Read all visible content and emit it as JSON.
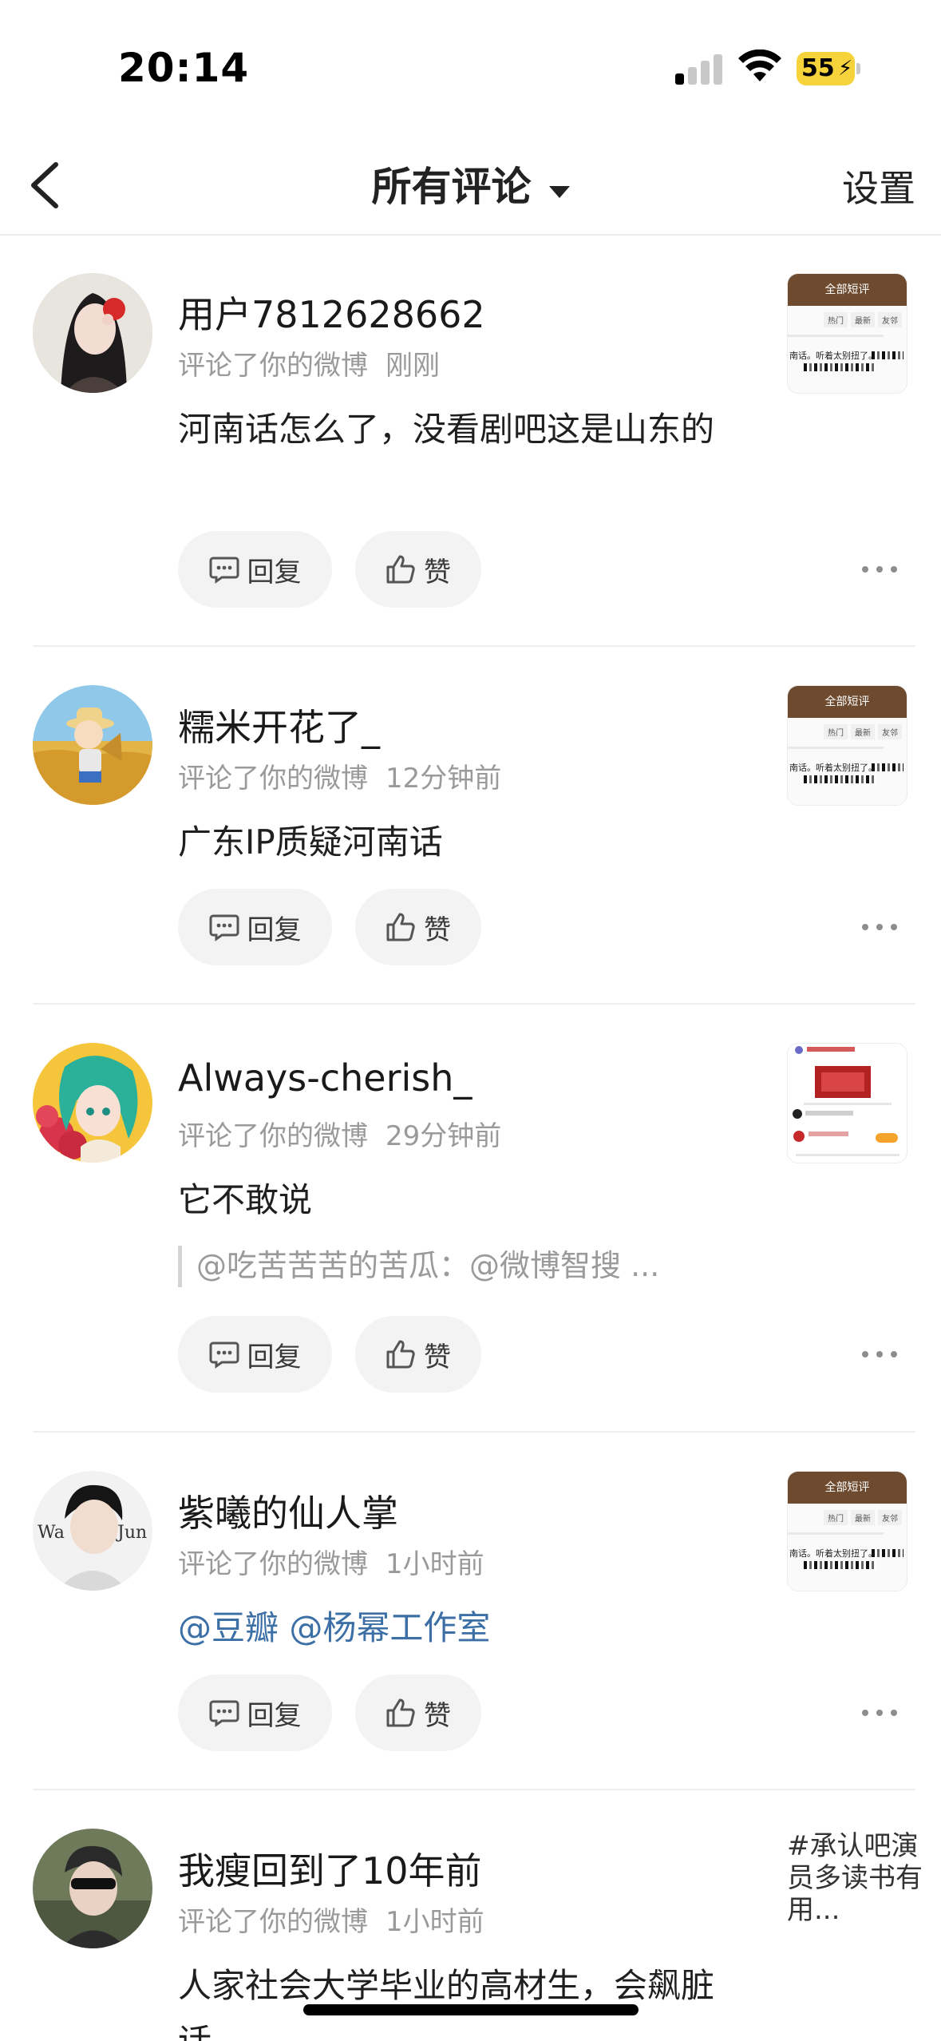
{
  "status_bar": {
    "time": "20:14",
    "battery": "55"
  },
  "nav": {
    "title": "所有评论",
    "settings": "设置"
  },
  "actions": {
    "reply": "回复",
    "like": "赞"
  },
  "comments": [
    {
      "username": "用户7812628662",
      "meta": "评论了你的微博",
      "time": "刚刚",
      "content": "河南话怎么了，没看剧吧这是山东的",
      "thumb_title": "全部短评"
    },
    {
      "username": "糯米开花了_",
      "meta": "评论了你的微博",
      "time": "12分钟前",
      "content": "广东IP质疑河南话",
      "thumb_title": "全部短评"
    },
    {
      "username": "Always-cherish_",
      "meta": "评论了你的微博",
      "time": "29分钟前",
      "content": "它不敢说",
      "quote": "@吃苦苦苦的苦瓜：@微博智搜 ..."
    },
    {
      "username": "紫曦的仙人掌",
      "meta": "评论了你的微博",
      "time": "1小时前",
      "content": "@豆瓣 @杨幂工作室",
      "thumb_title": "全部短评"
    },
    {
      "username": "我瘦回到了10年前",
      "meta": "评论了你的微博",
      "time": "1小时前",
      "content": "人家社会大学毕业的高材生，会飙脏话",
      "thumb_text": "#承认吧演员多读书有用..."
    }
  ]
}
